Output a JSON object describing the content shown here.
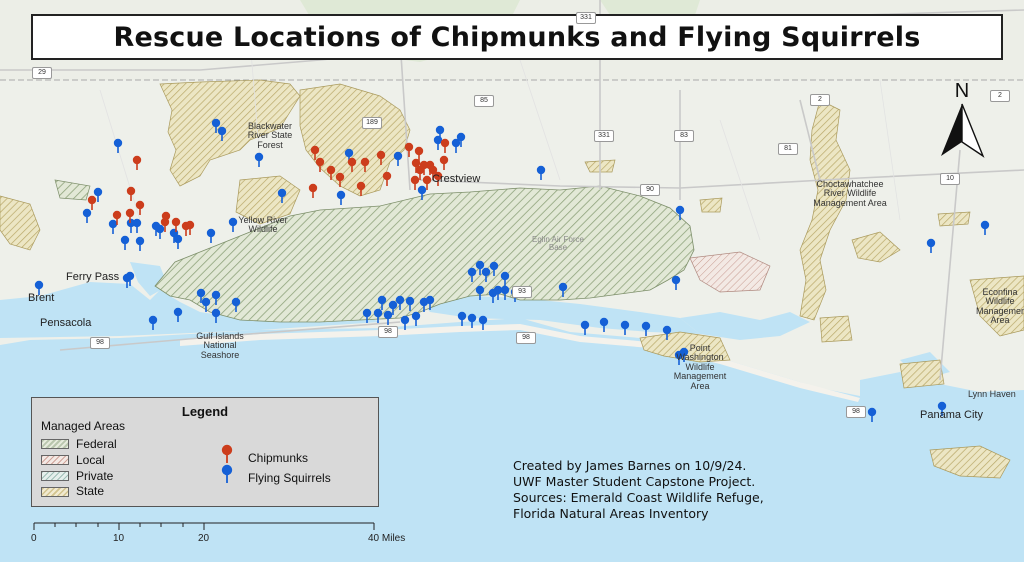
{
  "title": "Rescue Locations of Chipmunks and Flying Squirrels",
  "places": {
    "brent": "Brent",
    "pensacola": "Pensacola",
    "ferry_pass": "Ferry Pass",
    "crestview": "Crestview",
    "panama_city": "Panama City",
    "lynn_haven": "Lynn Haven",
    "blackwater": "Blackwater River State Forest",
    "yellow_river": "Yellow River Wildlife",
    "eglin": "Eglin Air Force Base",
    "gulf_islands": "Gulf Islands National Seashore",
    "choctawhatchee": "Choctawhatchee River Wildlife Management Area",
    "pt_washington": "Point Washington Wildlife Management Area",
    "econfina": "Econfina Wildlife Management Area"
  },
  "highways": [
    "331",
    "29",
    "189",
    "85",
    "331",
    "83",
    "81",
    "2",
    "2",
    "90",
    "10",
    "98",
    "98",
    "98",
    "98",
    "93"
  ],
  "north_label": "N",
  "legend": {
    "title": "Legend",
    "managed_areas_heading": "Managed Areas",
    "managed_areas": [
      "Federal",
      "Local",
      "Private",
      "State"
    ],
    "points": [
      {
        "label": "Chipmunks",
        "color": "#cc3d1c"
      },
      {
        "label": "Flying Squirrels",
        "color": "#1560d6"
      }
    ]
  },
  "credits": [
    "Created by James Barnes on 10/9/24.",
    "UWF Master Student Capstone Project.",
    "Sources: Emerald Coast Wildlife Refuge,",
    "Florida Natural Areas Inventory"
  ],
  "scale": {
    "ticks": [
      "0",
      "10",
      "20",
      "40 Miles"
    ]
  },
  "colors": {
    "water": "#bfe3f5",
    "land": "#eef0ea",
    "chipmunk": "#cc3d1c",
    "flying_squirrel": "#1560d6"
  }
}
